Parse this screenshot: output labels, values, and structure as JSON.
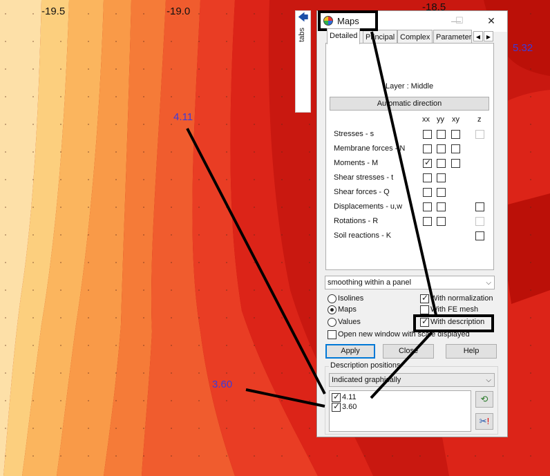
{
  "colors": {
    "contour_bands": [
      "#fde0a8",
      "#fccf7e",
      "#fbb55e",
      "#f99a48",
      "#f57b38",
      "#f05c2e",
      "#e93d24",
      "#dc2418",
      "#c91810",
      "#bb1008"
    ],
    "value_label": "#3b3bdc",
    "accent": "#0078d7"
  },
  "axis": {
    "ticks": [
      "-19.5",
      "-19.0",
      "-18.5"
    ]
  },
  "map_values": {
    "v1": "4.11",
    "v2": "3.60",
    "v3": "5.32"
  },
  "side_tab": {
    "label": "tabs",
    "arrow_icon": "arrow-left-icon"
  },
  "dialog": {
    "title": "Maps",
    "icon": "maps-logo-icon",
    "window_buttons": {
      "minimize": "—",
      "maximize": "☐",
      "close": "✕"
    },
    "tabs": [
      {
        "label": "Detailed",
        "active": true
      },
      {
        "label": "Principal",
        "active": false
      },
      {
        "label": "Complex",
        "active": false
      },
      {
        "label": "Parameter",
        "active": false
      }
    ],
    "tab_nav": {
      "prev": "◀",
      "next": "▶"
    },
    "layer_text": "Layer : Middle",
    "auto_direction_label": "Automatic direction",
    "columns": [
      "xx",
      "yy",
      "xy",
      "z"
    ],
    "rows": [
      {
        "label": "Stresses - s"
      },
      {
        "label": "Membrane forces - N"
      },
      {
        "label": "Moments - M"
      },
      {
        "label": "Shear stresses - t"
      },
      {
        "label": "Shear forces - Q"
      },
      {
        "label": "Displacements - u,w"
      },
      {
        "label": "Rotations - R"
      },
      {
        "label": "Soil reactions - K"
      }
    ],
    "smoothing": {
      "selected": "smoothing within a panel"
    },
    "display_mode": {
      "options": [
        "Isolines",
        "Maps",
        "Values"
      ],
      "selected": "Maps"
    },
    "options": {
      "with_normalization": {
        "label": "With normalization",
        "checked": true
      },
      "with_fe_mesh": {
        "label": "With FE mesh",
        "checked": false
      },
      "with_description": {
        "label": "With description",
        "checked": true
      }
    },
    "open_new_window": {
      "label": "Open new window with scale displayed",
      "checked": false
    },
    "buttons": {
      "apply": "Apply",
      "close": "Close",
      "help": "Help"
    },
    "description_positions": {
      "legend": "Description positions",
      "mode": "Indicated graphically",
      "items": [
        {
          "label": "4.11",
          "checked": true
        },
        {
          "label": "3.60",
          "checked": true
        }
      ],
      "refresh_icon": "refresh-icon",
      "delete_icon": "cut-delete-icon"
    }
  }
}
